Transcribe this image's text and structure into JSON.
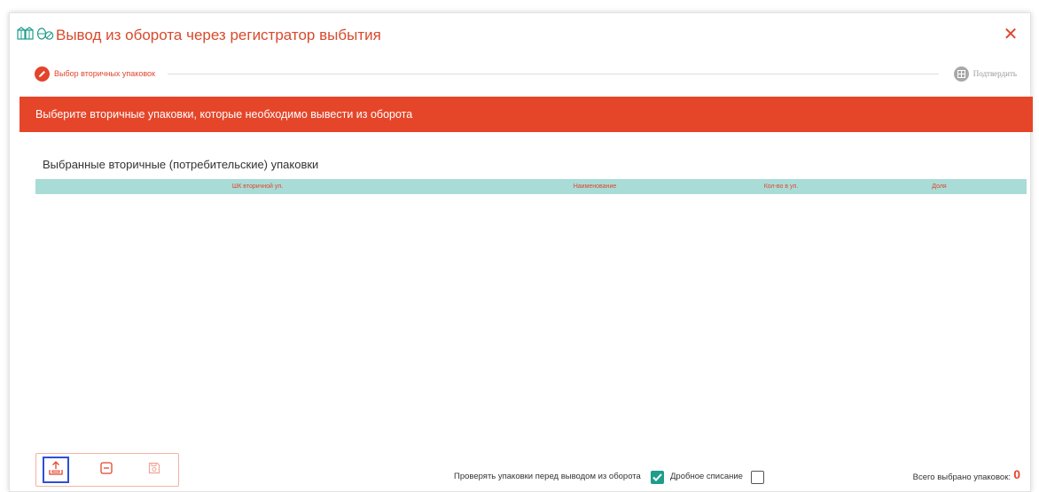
{
  "window": {
    "title": "Вывод из оборота через регистратор выбытия",
    "close_symbol": "✕"
  },
  "stepper": {
    "steps": [
      {
        "label": "Выбор вторичных упаковок",
        "icon": "pencil-icon",
        "active": true
      },
      {
        "label": "Подтвердить",
        "icon": "grid-icon",
        "active": false
      }
    ]
  },
  "banner": {
    "text": "Выберите вторичные упаковки, которые необходимо вывести из оборота"
  },
  "section": {
    "title": "Выбранные вторичные (потребительские) упаковки"
  },
  "table": {
    "columns": [
      "ШК вторичной уп.",
      "Наименование",
      "Кол-во в уп.",
      "Доля"
    ],
    "rows": []
  },
  "toolbar": {
    "buttons": [
      {
        "name": "upload-button",
        "icon": "upload-icon",
        "selected": true
      },
      {
        "name": "remove-button",
        "icon": "minus-box-icon",
        "selected": false
      },
      {
        "name": "save-button",
        "icon": "floppy-icon",
        "selected": false
      }
    ]
  },
  "footer": {
    "check_before_label": "Проверять упаковки перед выводом из оборота",
    "check_before_checked": true,
    "fractional_label": "Дробное списание",
    "fractional_checked": false,
    "total_label": "Всего выбрано упаковок:",
    "total_value": "0"
  },
  "colors": {
    "accent": "#e5462a",
    "table_header": "#a9dcd7",
    "checkbox_checked": "#1e9d8b",
    "icon_teal": "#1e9d8b",
    "selected_outline": "#2f4fd8"
  }
}
